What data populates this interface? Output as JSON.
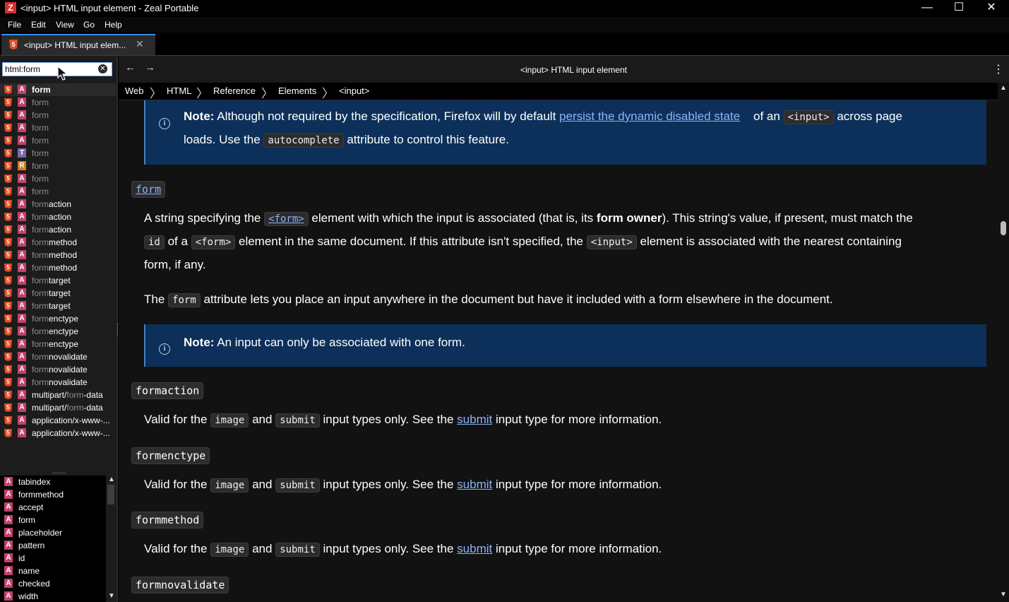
{
  "window": {
    "app_icon_letter": "Z",
    "title": "<input> HTML input element - Zeal Portable",
    "controls": {
      "minimize": "—",
      "maximize": "☐",
      "close": "✕"
    }
  },
  "menu": [
    "File",
    "Edit",
    "View",
    "Go",
    "Help"
  ],
  "tab": {
    "icon_letter": "5",
    "label": "<input> HTML input elem...",
    "close": "✕"
  },
  "search": {
    "value": "html:form",
    "clear": "✕"
  },
  "results": [
    {
      "type": "A",
      "match": "form",
      "rest": "",
      "selected": true
    },
    {
      "type": "A",
      "match": "form",
      "rest": ""
    },
    {
      "type": "A",
      "match": "form",
      "rest": ""
    },
    {
      "type": "A",
      "match": "form",
      "rest": ""
    },
    {
      "type": "A",
      "match": "form",
      "rest": ""
    },
    {
      "type": "T",
      "match": "form",
      "rest": ""
    },
    {
      "type": "R",
      "match": "form",
      "rest": ""
    },
    {
      "type": "A",
      "match": "form",
      "rest": ""
    },
    {
      "type": "A",
      "match": "form",
      "rest": ""
    },
    {
      "type": "A",
      "match": "form",
      "rest": "action"
    },
    {
      "type": "A",
      "match": "form",
      "rest": "action"
    },
    {
      "type": "A",
      "match": "form",
      "rest": "action"
    },
    {
      "type": "A",
      "match": "form",
      "rest": "method"
    },
    {
      "type": "A",
      "match": "form",
      "rest": "method"
    },
    {
      "type": "A",
      "match": "form",
      "rest": "method"
    },
    {
      "type": "A",
      "match": "form",
      "rest": "target"
    },
    {
      "type": "A",
      "match": "form",
      "rest": "target"
    },
    {
      "type": "A",
      "match": "form",
      "rest": "target"
    },
    {
      "type": "A",
      "match": "form",
      "rest": "enctype"
    },
    {
      "type": "A",
      "match": "form",
      "rest": "enctype"
    },
    {
      "type": "A",
      "match": "form",
      "rest": "enctype"
    },
    {
      "type": "A",
      "match": "form",
      "rest": "novalidate"
    },
    {
      "type": "A",
      "match": "form",
      "rest": "novalidate"
    },
    {
      "type": "A",
      "match": "form",
      "rest": "novalidate"
    },
    {
      "type": "A",
      "pre": "multipart/",
      "match": "form",
      "rest": "-data"
    },
    {
      "type": "A",
      "pre": "multipart/",
      "match": "form",
      "rest": "-data"
    },
    {
      "type": "A",
      "pre": "application/x-www-...",
      "match": "",
      "rest": ""
    },
    {
      "type": "A",
      "pre": "application/x-www-...",
      "match": "",
      "rest": ""
    }
  ],
  "toc": [
    "tabindex",
    "formmethod",
    "accept",
    "form",
    "placeholder",
    "pattern",
    "id",
    "name",
    "checked",
    "width"
  ],
  "toc_icon": "A",
  "nav": {
    "back": "←",
    "forward": "→",
    "title": "<input> HTML input element",
    "menu": "⋮"
  },
  "breadcrumb": [
    "Web",
    "HTML",
    "Reference",
    "Elements",
    "<input>"
  ],
  "breadcrumb_sep": "〉",
  "info_icon": "i",
  "doc": {
    "note1": {
      "label": "Note:",
      "l1_a": "Although not required by the specification, Firefox will by default",
      "l1_link": "persist the dynamic disabled state",
      "l1_b": "of an",
      "l1_code": "<input>",
      "l1_c": "across page",
      "l2_a": "loads. Use the",
      "l2_code": "autocomplete",
      "l2_b": "attribute to control this feature."
    },
    "h_form": "form",
    "p1": {
      "a": "A string specifying the",
      "code1": "<form>",
      "b": "element with which the input is associated (that is, its",
      "bold": "form owner",
      "c": "). This string's value, if present, must match the",
      "code2": "id",
      "d": "of a",
      "code3": "<form>",
      "e": "element in the same document. If this attribute isn't specified, the",
      "code4": "<input>",
      "f": "element is associated with the nearest containing",
      "g": "form, if any."
    },
    "p2": {
      "a": "The",
      "code": "form",
      "b": "attribute lets you place an input anywhere in the document but have it included with a form elsewhere in the document."
    },
    "note2": {
      "label": "Note:",
      "text": "An input can only be associated with one form."
    },
    "sections": [
      {
        "heading": "formaction",
        "a": "Valid for the",
        "code1": "image",
        "b": "and",
        "code2": "submit",
        "c": "input types only. See the",
        "link": "submit",
        "d": "input type for more information."
      },
      {
        "heading": "formenctype",
        "a": "Valid for the",
        "code1": "image",
        "b": "and",
        "code2": "submit",
        "c": "input types only. See the",
        "link": "submit",
        "d": "input type for more information."
      },
      {
        "heading": "formmethod",
        "a": "Valid for the",
        "code1": "image",
        "b": "and",
        "code2": "submit",
        "c": "input types only. See the",
        "link": "submit",
        "d": "input type for more information."
      }
    ],
    "h_last": "formnovalidate"
  },
  "scroll": {
    "up": "▲",
    "down": "▼"
  }
}
